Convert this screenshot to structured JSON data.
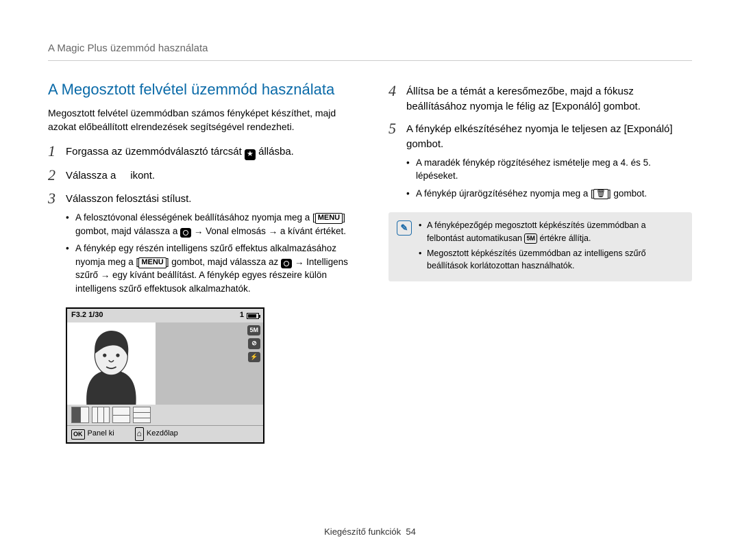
{
  "breadcrumb": "A Magic Plus üzemmód használata",
  "section_title": "A Megosztott felvétel üzemmód használata",
  "intro": "Megosztott felvétel üzemmódban számos fényképet készíthet, majd azokat előbeállított elrendezések segítségével rendezheti.",
  "steps_left": {
    "s1": {
      "num": "1",
      "text_before": "Forgassa az üzemmódválasztó tárcsát ",
      "text_after": " állásba."
    },
    "s2": {
      "num": "2",
      "text_before": "Válassza a ",
      "text_after": " ikont."
    },
    "s3": {
      "num": "3",
      "text": "Válasszon felosztási stílust."
    }
  },
  "bullets_left": {
    "b1": {
      "line1_pre": "A felosztóvonal élességének beállításához nyomja meg a ",
      "line1_key": "MENU",
      "line2_pre": " gombot, majd válassza a ",
      "line2_post": " → Vonal elmosás → a kívánt értéket."
    },
    "b2": {
      "line1": "A fénykép egy részén intelligens szűrő effektus alkalmazásához nyomja meg a ",
      "key": "MENU",
      "line2_pre": " gombot, majd válassza az ",
      "line2_post": " → Intelligens szűrő → egy kívánt beállítást. A fénykép egyes részeire külön intelligens szűrő effektusok alkalmazhatók."
    }
  },
  "screenshot": {
    "exposure": "F3.2 1/30",
    "one": "1",
    "badge1": "5M",
    "badge2": "⊘",
    "badge3": "⚡",
    "ok": "OK",
    "panel": "Panel ki",
    "home": "Kezdőlap"
  },
  "steps_right": {
    "s4": {
      "num": "4",
      "text": "Állítsa be a témát a keresőmezőbe, majd a fókusz beállításához nyomja le félig az [Exponáló] gombot."
    },
    "s5": {
      "num": "5",
      "text": "A fénykép elkészítéséhez nyomja le teljesen az [Exponáló] gombot."
    }
  },
  "bullets_right": {
    "b1": "A maradék fénykép rögzítéséhez ismételje meg a 4. és 5. lépéseket.",
    "b2_pre": "A fénykép újrarögzítéséhez nyomja meg a ",
    "b2_post": " gombot."
  },
  "note": {
    "n1_pre": "A fényképezőgép megosztott képkészítés üzemmódban a felbontást automatikusan ",
    "n1_badge": "5M",
    "n1_post": " értékre állítja.",
    "n2": "Megosztott képkészítés üzemmódban az intelligens szűrő beállítások korlátozottan használhatók."
  },
  "footer": {
    "label": "Kiegészítő funkciók",
    "page": "54"
  }
}
